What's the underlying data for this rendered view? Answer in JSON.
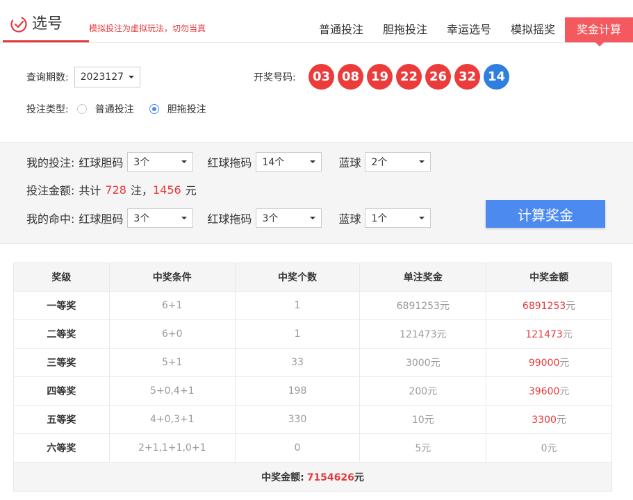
{
  "header": {
    "logo_text": "选号",
    "warning": "模拟投注为虚拟玩法，切勿当真",
    "nav": [
      "普通投注",
      "胆拖投注",
      "幸运选号",
      "模拟摇奖",
      "奖金计算"
    ]
  },
  "query": {
    "period_label": "查询期数:",
    "period_value": "2023127",
    "draw_label": "开奖号码:",
    "red_balls": [
      "03",
      "08",
      "19",
      "22",
      "26",
      "32"
    ],
    "blue_ball": "14",
    "type_label": "投注类型:",
    "type_options": [
      "普通投注",
      "胆拖投注"
    ],
    "type_selected": "胆拖投注"
  },
  "calc": {
    "my_bet_label": "我的投注:",
    "red_dan_label": "红球胆码",
    "red_tuo_label": "红球拖码",
    "blue_label": "蓝球",
    "bet_red_dan": "3个",
    "bet_red_tuo": "14个",
    "bet_blue": "2个",
    "amount_label": "投注金额:",
    "amount_prefix": "共计",
    "bets_count": "728",
    "bets_unit": "注，",
    "money": "1456",
    "money_unit": "元",
    "my_hit_label": "我的命中:",
    "hit_red_dan": "3个",
    "hit_red_tuo": "3个",
    "hit_blue": "1个",
    "button": "计算奖金"
  },
  "table": {
    "headers": [
      "奖级",
      "中奖条件",
      "中奖个数",
      "单注奖金",
      "中奖金额"
    ],
    "rows": [
      {
        "level": "一等奖",
        "cond": "6+1",
        "count": "1",
        "single": "6891253元",
        "total_num": "6891253",
        "total_unit": "元"
      },
      {
        "level": "二等奖",
        "cond": "6+0",
        "count": "1",
        "single": "121473元",
        "total_num": "121473",
        "total_unit": "元"
      },
      {
        "level": "三等奖",
        "cond": "5+1",
        "count": "33",
        "single": "3000元",
        "total_num": "99000",
        "total_unit": "元"
      },
      {
        "level": "四等奖",
        "cond": "5+0,4+1",
        "count": "198",
        "single": "200元",
        "total_num": "39600",
        "total_unit": "元"
      },
      {
        "level": "五等奖",
        "cond": "4+0,3+1",
        "count": "330",
        "single": "10元",
        "total_num": "3300",
        "total_unit": "元"
      },
      {
        "level": "六等奖",
        "cond": "2+1,1+1,0+1",
        "count": "0",
        "single": "5元",
        "total_num": "0元",
        "total_unit": ""
      }
    ],
    "total_label": "中奖金额:",
    "total_value": "7154626",
    "total_unit": "元"
  },
  "colors": {
    "accent_red": "#e4393c",
    "ball_red": "#ec3b3b",
    "ball_blue": "#2f7fe0",
    "button_blue": "#4d8af0"
  }
}
